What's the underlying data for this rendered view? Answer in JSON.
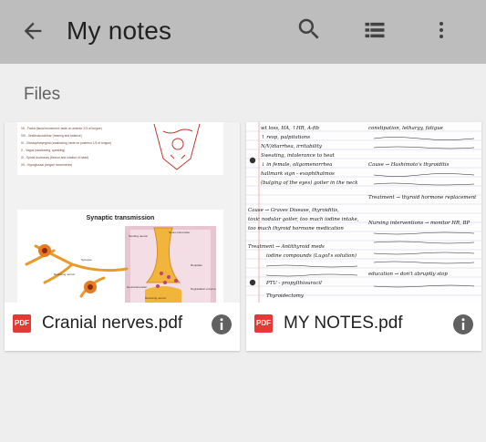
{
  "appbar": {
    "title": "My notes",
    "icons": [
      "back-arrow-icon",
      "search-icon",
      "list-view-icon",
      "more-vert-icon"
    ],
    "background": "#bdbdbd"
  },
  "section": {
    "label": "Files"
  },
  "files": [
    {
      "name": "Cranial nerves.pdf",
      "type_badge": "PDF",
      "thumbnail": {
        "top_lines": [
          "VII - Facial (facial movement; taste on anterior 2/3 of tongue)",
          "VIII - Vestibulocochlear (hearing and balance)",
          "IX - Glossopharyngeal (swallowing; taste on posterior 1/3 of tongue)",
          "X - Vagus (swallowing, speaking)",
          "XI - Spinal Accessory (flexion and rotation of head)",
          "XII - Hypoglossal (tongue movements)"
        ],
        "diagram_title": "Synaptic transmission",
        "diagram_labels": [
          "Sending neuron",
          "Neuro-transmitter",
          "Synapse",
          "Receiving neuron",
          "Neurotransmitter",
          "Receiving neuron",
          "Degradation enzyme",
          "Reuptake"
        ]
      }
    },
    {
      "name": "MY NOTES.pdf",
      "type_badge": "PDF",
      "thumbnail": {
        "note_lines": [
          "wt loss, HA, ↑HR, A-fib",
          "↑ resp, palpitations",
          "N/V/diarrhea, irritability",
          "Sweating, intolerance to heat",
          "↓ in female, oligomenorrhea",
          "hallmark sign - exophthalmos",
          "(bulging of the eyes) goiter in the neck",
          "Cause → Graves Disease, thyroiditis,",
          "toxic nodular goiter, too much iodine intake,",
          "too much thyroid hormone medication",
          "Treatment → Antithyroid meds",
          "iodine compounds (Lugol's solution)",
          "PTU - propylthiouracil",
          "Thyroidectomy",
          "constipation, lethargy, fatigue",
          "Cause → Hashimoto's thyroiditis",
          "Treatment → thyroid hormone replacement",
          "Nursing interventions → monitor HR, BP",
          "education → don't abruptly stop"
        ]
      }
    }
  ]
}
